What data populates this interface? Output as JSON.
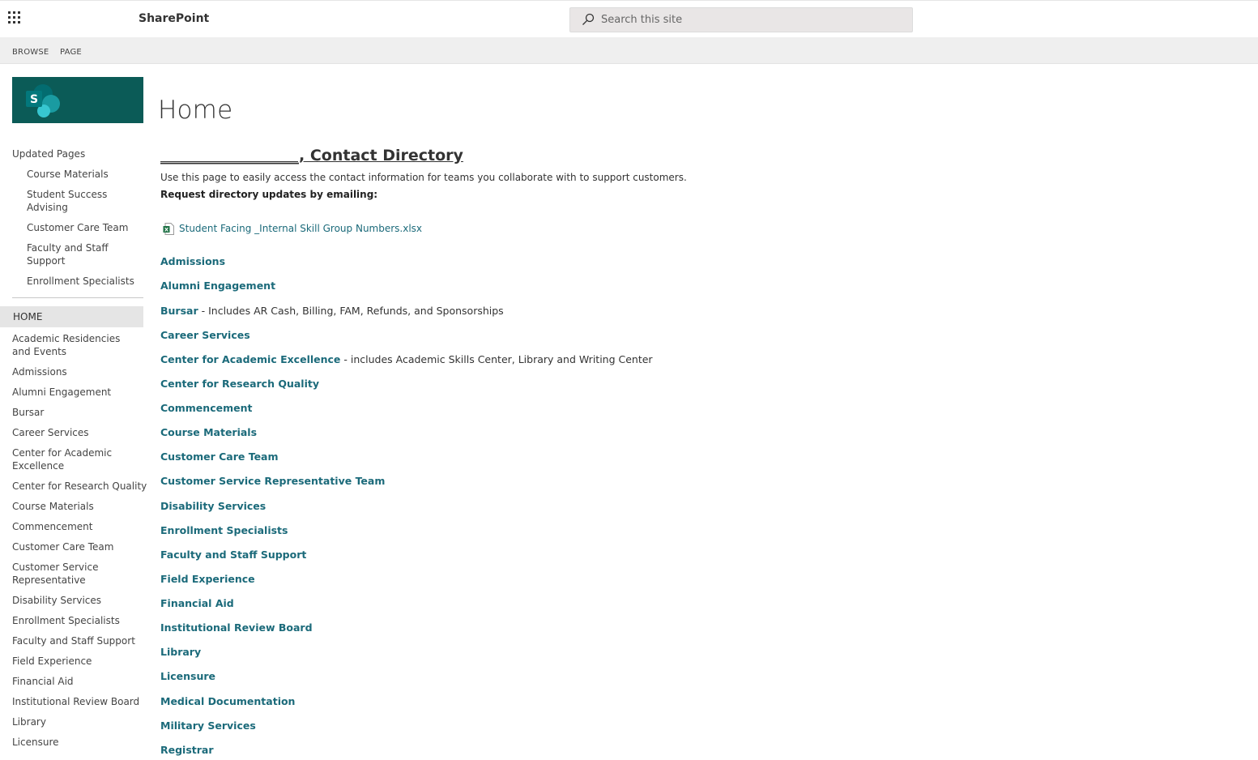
{
  "suite_bar": {
    "app_title": "SharePoint",
    "search_placeholder": "Search this site"
  },
  "ribbon": {
    "tabs": [
      "BROWSE",
      "PAGE"
    ]
  },
  "left_nav": {
    "logo_letter": "S",
    "recent_heading": "Updated Pages",
    "recent_items": [
      "Course Materials",
      "Student Success Advising",
      "Customer Care Team",
      "Faculty and Staff Support",
      "Enrollment Specialists"
    ],
    "home_label": "HOME",
    "items": [
      "Academic Residencies and Events",
      "Admissions",
      "Alumni Engagement",
      "Bursar",
      "Career Services",
      "Center for Academic Excellence",
      "Center for Research Quality",
      "Course Materials",
      "Commencement",
      "Customer Care Team",
      "Customer Service Representative",
      "Disability Services",
      "Enrollment Specialists",
      "Faculty and Staff Support",
      "Field Experience",
      "Financial Aid",
      "Institutional Review Board",
      "Library",
      "Licensure"
    ]
  },
  "main": {
    "page_title": "Home",
    "directory_heading": "__________________, Contact Directory",
    "intro_text": "Use this page to easily access the contact information for teams you collaborate with to support customers.",
    "request_text": "Request directory updates by emailing:",
    "file_link": "Student Facing _Internal Skill Group Numbers.xlsx",
    "departments": [
      {
        "name": "Admissions",
        "note": ""
      },
      {
        "name": "Alumni Engagement",
        "note": ""
      },
      {
        "name": "Bursar",
        "note": " - Includes AR Cash, Billing, FAM, Refunds, and Sponsorships"
      },
      {
        "name": "Career Services",
        "note": ""
      },
      {
        "name": "Center for Academic Excellence",
        "note": " - includes Academic Skills Center, Library and Writing Center"
      },
      {
        "name": "Center for Research Quality",
        "note": ""
      },
      {
        "name": "Commencement",
        "note": ""
      },
      {
        "name": "Course Materials",
        "note": ""
      },
      {
        "name": "Customer Care Team",
        "note": ""
      },
      {
        "name": "Customer Service Representative Team",
        "note": ""
      },
      {
        "name": "Disability Services",
        "note": ""
      },
      {
        "name": "Enrollment Specialists",
        "note": ""
      },
      {
        "name": "Faculty and Staff Support",
        "note": ""
      },
      {
        "name": "Field Experience",
        "note": ""
      },
      {
        "name": "Financial Aid",
        "note": ""
      },
      {
        "name": "Institutional Review Board",
        "note": ""
      },
      {
        "name": "Library",
        "note": ""
      },
      {
        "name": "Licensure",
        "note": ""
      },
      {
        "name": "Medical Documentation",
        "note": ""
      },
      {
        "name": "Military Services",
        "note": ""
      },
      {
        "name": "Registrar",
        "note": ""
      }
    ]
  },
  "colors": {
    "link": "#1b6a7a",
    "logo_bg": "#0b5b57",
    "ribbon_bg": "#efefef",
    "home_bg": "#e5e5e5"
  }
}
